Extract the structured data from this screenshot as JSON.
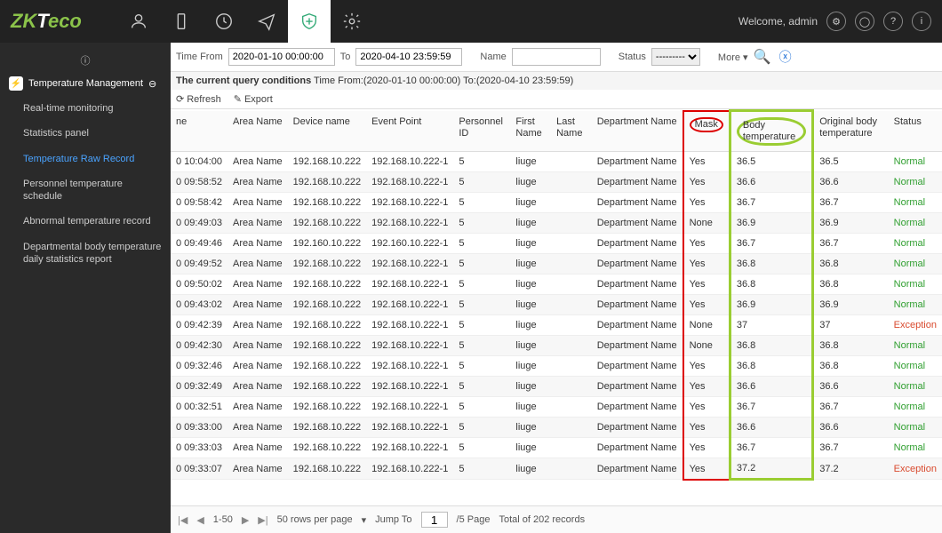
{
  "header": {
    "welcome": "Welcome, admin"
  },
  "sidebar": {
    "group": "Temperature Management",
    "items": [
      "Real-time monitoring",
      "Statistics panel",
      "Temperature Raw Record",
      "Personnel temperature schedule",
      "Abnormal temperature record",
      "Departmental body temperature daily statistics report"
    ]
  },
  "filter": {
    "time_from_label": "Time From",
    "time_from_value": "2020-01-10 00:00:00",
    "to_label": "To",
    "time_to_value": "2020-04-10 23:59:59",
    "name_label": "Name",
    "name_value": "",
    "status_label": "Status",
    "status_value": "---------",
    "more": "More ▾"
  },
  "cond": {
    "prefix": "The current query conditions",
    "text": "Time From:(2020-01-10 00:00:00)  To:(2020-04-10 23:59:59)"
  },
  "actions": {
    "refresh": "Refresh",
    "export": "Export"
  },
  "columns": [
    "ne",
    "Area Name",
    "Device name",
    "Event Point",
    "Personnel ID",
    "First Name",
    "Last Name",
    "Department Name",
    "Mask",
    "Body temperature",
    "Original body temperature",
    "Status"
  ],
  "rows": [
    {
      "time": "0 10:04:00",
      "area": "Area Name",
      "dev": "192.168.10.222",
      "ep": "192.168.10.222-1",
      "pid": "5",
      "fn": "liuge",
      "ln": "",
      "dept": "Department Name",
      "mask": "Yes",
      "bt": "36.5",
      "obt": "36.5",
      "st": "Normal"
    },
    {
      "time": "0 09:58:52",
      "area": "Area Name",
      "dev": "192.168.10.222",
      "ep": "192.168.10.222-1",
      "pid": "5",
      "fn": "liuge",
      "ln": "",
      "dept": "Department Name",
      "mask": "Yes",
      "bt": "36.6",
      "obt": "36.6",
      "st": "Normal"
    },
    {
      "time": "0 09:58:42",
      "area": "Area Name",
      "dev": "192.168.10.222",
      "ep": "192.168.10.222-1",
      "pid": "5",
      "fn": "liuge",
      "ln": "",
      "dept": "Department Name",
      "mask": "Yes",
      "bt": "36.7",
      "obt": "36.7",
      "st": "Normal"
    },
    {
      "time": "0 09:49:03",
      "area": "Area Name",
      "dev": "192.168.10.222",
      "ep": "192.168.10.222-1",
      "pid": "5",
      "fn": "liuge",
      "ln": "",
      "dept": "Department Name",
      "mask": "None",
      "bt": "36.9",
      "obt": "36.9",
      "st": "Normal"
    },
    {
      "time": "0 09:49:46",
      "area": "Area Name",
      "dev": "192.160.10.222",
      "ep": "192.160.10.222-1",
      "pid": "5",
      "fn": "liuge",
      "ln": "",
      "dept": "Department Name",
      "mask": "Yes",
      "bt": "36.7",
      "obt": "36.7",
      "st": "Normal"
    },
    {
      "time": "0 09:49:52",
      "area": "Area Name",
      "dev": "192.168.10.222",
      "ep": "192.168.10.222-1",
      "pid": "5",
      "fn": "liuge",
      "ln": "",
      "dept": "Department Name",
      "mask": "Yes",
      "bt": "36.8",
      "obt": "36.8",
      "st": "Normal"
    },
    {
      "time": "0 09:50:02",
      "area": "Area Name",
      "dev": "192.168.10.222",
      "ep": "192.168.10.222-1",
      "pid": "5",
      "fn": "liuge",
      "ln": "",
      "dept": "Department Name",
      "mask": "Yes",
      "bt": "36.8",
      "obt": "36.8",
      "st": "Normal"
    },
    {
      "time": "0 09:43:02",
      "area": "Area Name",
      "dev": "192.168.10.222",
      "ep": "192.168.10.222-1",
      "pid": "5",
      "fn": "liuge",
      "ln": "",
      "dept": "Department Name",
      "mask": "Yes",
      "bt": "36.9",
      "obt": "36.9",
      "st": "Normal"
    },
    {
      "time": "0 09:42:39",
      "area": "Area Name",
      "dev": "192.168.10.222",
      "ep": "192.168.10.222-1",
      "pid": "5",
      "fn": "liuge",
      "ln": "",
      "dept": "Department Name",
      "mask": "None",
      "bt": "37",
      "obt": "37",
      "st": "Exception"
    },
    {
      "time": "0 09:42:30",
      "area": "Area Name",
      "dev": "192.168.10.222",
      "ep": "192.168.10.222-1",
      "pid": "5",
      "fn": "liuge",
      "ln": "",
      "dept": "Department Name",
      "mask": "None",
      "bt": "36.8",
      "obt": "36.8",
      "st": "Normal"
    },
    {
      "time": "0 09:32:46",
      "area": "Area Name",
      "dev": "192.168.10.222",
      "ep": "192.168.10.222-1",
      "pid": "5",
      "fn": "liuge",
      "ln": "",
      "dept": "Department Name",
      "mask": "Yes",
      "bt": "36.8",
      "obt": "36.8",
      "st": "Normal"
    },
    {
      "time": "0 09:32:49",
      "area": "Area Name",
      "dev": "192.168.10.222",
      "ep": "192.168.10.222-1",
      "pid": "5",
      "fn": "liuge",
      "ln": "",
      "dept": "Department Name",
      "mask": "Yes",
      "bt": "36.6",
      "obt": "36.6",
      "st": "Normal"
    },
    {
      "time": "0 00:32:51",
      "area": "Area Name",
      "dev": "192.168.10.222",
      "ep": "192.168.10.222-1",
      "pid": "5",
      "fn": "liuge",
      "ln": "",
      "dept": "Department Name",
      "mask": "Yes",
      "bt": "36.7",
      "obt": "36.7",
      "st": "Normal"
    },
    {
      "time": "0 09:33:00",
      "area": "Area Name",
      "dev": "192.168.10.222",
      "ep": "192.168.10.222-1",
      "pid": "5",
      "fn": "liuge",
      "ln": "",
      "dept": "Department Name",
      "mask": "Yes",
      "bt": "36.6",
      "obt": "36.6",
      "st": "Normal"
    },
    {
      "time": "0 09:33:03",
      "area": "Area Name",
      "dev": "192.168.10.222",
      "ep": "192.168.10.222-1",
      "pid": "5",
      "fn": "liuge",
      "ln": "",
      "dept": "Department Name",
      "mask": "Yes",
      "bt": "36.7",
      "obt": "36.7",
      "st": "Normal"
    },
    {
      "time": "0 09:33:07",
      "area": "Area Name",
      "dev": "192.168.10.222",
      "ep": "192.168.10.222-1",
      "pid": "5",
      "fn": "liuge",
      "ln": "",
      "dept": "Department Name",
      "mask": "Yes",
      "bt": "37.2",
      "obt": "37.2",
      "st": "Exception"
    }
  ],
  "pager": {
    "range": "1-50",
    "rows_per_page": "50 rows per page",
    "jump_label": "Jump To",
    "jump_value": "1",
    "page_suffix": "/5 Page",
    "total": "Total of 202 records"
  }
}
